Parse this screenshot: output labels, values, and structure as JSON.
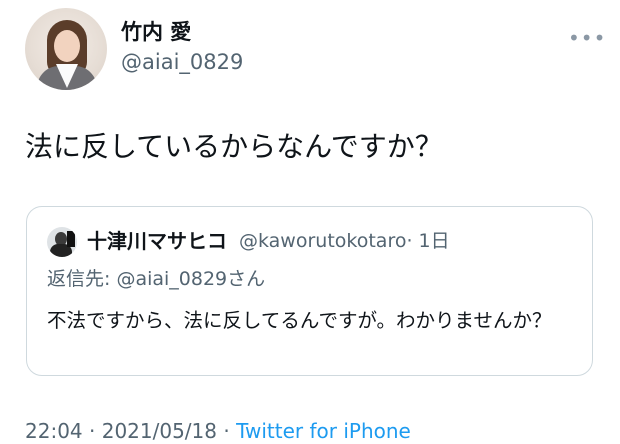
{
  "author": {
    "display_name": "竹内 愛",
    "handle": "@aiai_0829"
  },
  "tweet": {
    "text": "法に反しているからなんですか？"
  },
  "quote": {
    "display_name": "十津川マサヒコ",
    "handle": "@kaworutokotaro",
    "time": "· 1日",
    "reply_prefix": "返信先: ",
    "reply_mention": "@aiai_0829",
    "reply_suffix": "さん",
    "text": "不法ですから、法に反してるんですが。わかりませんか？"
  },
  "meta": {
    "time": "22:04",
    "separator1": " · ",
    "date": "2021/05/18",
    "separator2": " · ",
    "source": "Twitter for iPhone"
  },
  "icons": {
    "more": "more-icon"
  },
  "colors": {
    "link": "#1d9bf0",
    "secondary_text": "#536471",
    "border": "#cfd9de"
  }
}
